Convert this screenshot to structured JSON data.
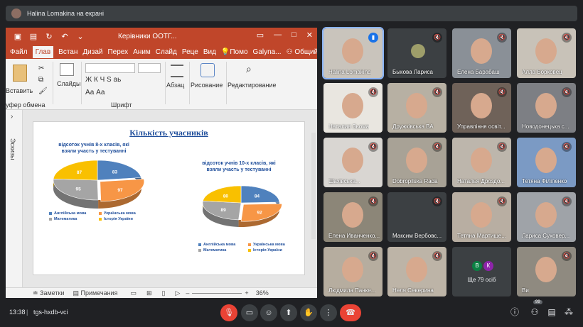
{
  "top": {
    "presenter": "Halina Lomakina на екрані"
  },
  "ppt": {
    "title": "Керівники ООТГ...",
    "tabs": [
      "Файл",
      "Глав",
      "Встан",
      "Дизай",
      "Перех",
      "Аним",
      "Слайд",
      "Реце",
      "Вид",
      "Помо",
      "Galyna...",
      "Общий досту"
    ],
    "ribbon": {
      "paste": "Вставить",
      "slides": "Слайды",
      "paragraph": "Абзац",
      "drawing": "Рисование",
      "editing": "Редактирование",
      "clipboard": "уфер обмена",
      "font": "Шрифт",
      "font_samples": "Ж К Ч S аь",
      "font_samples2": "Аа Аа"
    },
    "sidepanel": "Эскизы",
    "status": {
      "notes": "Заметки",
      "comments": "Примечания",
      "zoom": "36%"
    }
  },
  "slide": {
    "title": "Кількість учасників",
    "chart1_title": "відсоток учнів 8-х класів, які взяли участь у тестуванні",
    "chart2_title": "відсоток учнів 10-х класів, які взяли участь у тестуванні"
  },
  "chart_data": [
    {
      "type": "pie",
      "title": "відсоток учнів 8-х класів, які взяли участь у тестуванні",
      "categories": [
        "Англійська мова",
        "Українська мова",
        "Математика",
        "Історія України"
      ],
      "values": [
        83,
        97,
        95,
        87
      ],
      "colors": [
        "#4f81bd",
        "#f79646",
        "#a5a5a5",
        "#f9c000"
      ],
      "legend": [
        "Англійська мова",
        "Українська мова",
        "Математика",
        "Історія України"
      ]
    },
    {
      "type": "pie",
      "title": "відсоток учнів 10-х класів, які взяли участь у тестуванні",
      "categories": [
        "Англійська мова",
        "Українська мова",
        "Математика",
        "Історія України"
      ],
      "values": [
        84,
        92,
        89,
        80
      ],
      "colors": [
        "#4f81bd",
        "#f79646",
        "#a5a5a5",
        "#f9c000"
      ],
      "legend": [
        "Англійська мова",
        "Українська мова",
        "Математика",
        "Історія України"
      ]
    }
  ],
  "participants": [
    {
      "name": "Halina Lomakina",
      "bg": "#c9c4bc"
    },
    {
      "name": "Быкова Лариса",
      "bg": "#3c4043"
    },
    {
      "name": "Елена Барабаш",
      "bg": "#8a9097"
    },
    {
      "name": "Алла Борковец",
      "bg": "#c8c2b8"
    },
    {
      "name": "Наталия Зьома",
      "bg": "#e9e6e0"
    },
    {
      "name": "Дружківська ВА",
      "bg": "#b7b0a3"
    },
    {
      "name": "Управління освіт...",
      "bg": "#6f6259"
    },
    {
      "name": "Новодонецька с...",
      "bg": "#7d7f84"
    },
    {
      "name": "Шахівська...",
      "bg": "#d9d6d2"
    },
    {
      "name": "Dobropilska Rada",
      "bg": "#a8a296"
    },
    {
      "name": "Наталья Дроздо...",
      "bg": "#bdb6ac"
    },
    {
      "name": "Тетяна Філіпенко",
      "bg": "#7b9ac4"
    },
    {
      "name": "Елена Иванченко...",
      "bg": "#8c8678"
    },
    {
      "name": "Максим Вербовс...",
      "bg": "#3c4043"
    },
    {
      "name": "Тетяна Мартище...",
      "bg": "#b8aea2"
    },
    {
      "name": "Лариса Суховер...",
      "bg": "#9fa3a8"
    },
    {
      "name": "Людмила Панке...",
      "bg": "#b6ad9f"
    },
    {
      "name": "Неля Северина",
      "bg": "#bdb4a7"
    },
    {
      "name": "Ще 79 осіб",
      "bg": "#3c4043"
    },
    {
      "name": "Ви",
      "bg": "#8f8a80"
    }
  ],
  "more": {
    "initials": [
      "В",
      "К"
    ],
    "label": "Ще 79 осіб"
  },
  "bottom": {
    "time": "13:38",
    "code": "tgs-hxdb-vci",
    "badge": "99"
  }
}
